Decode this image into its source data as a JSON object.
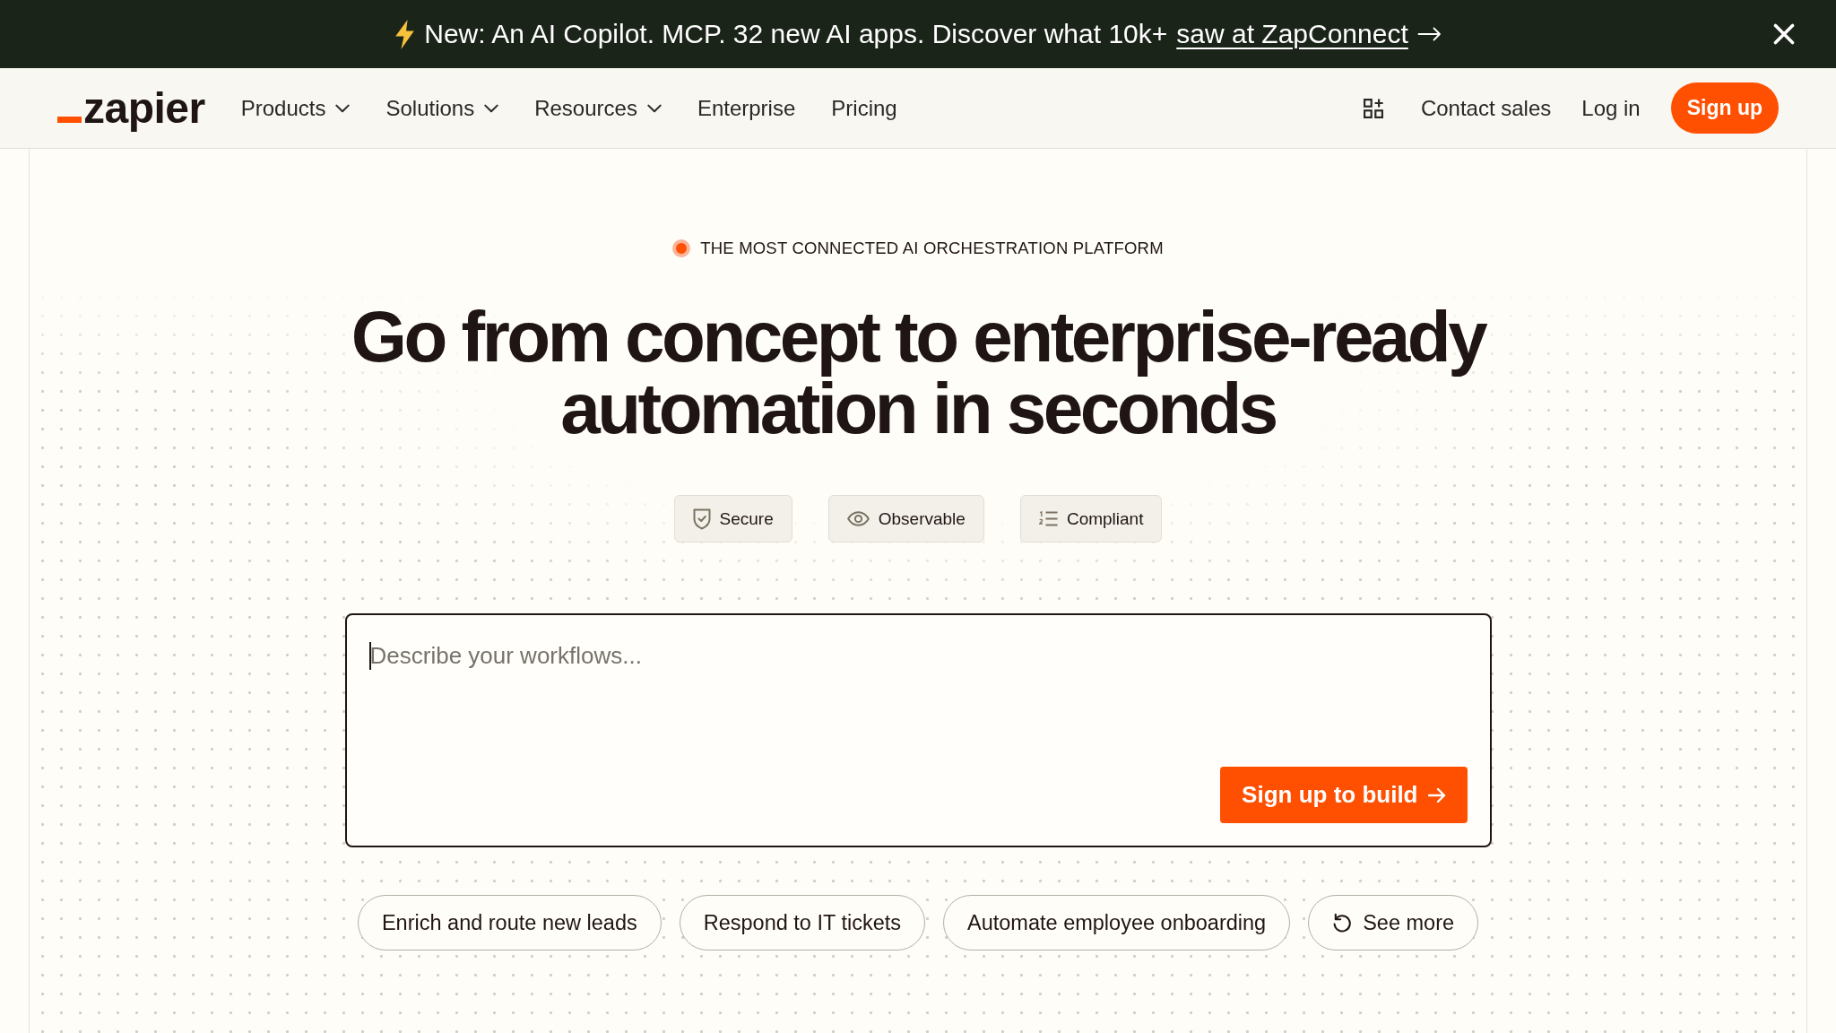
{
  "announcement": {
    "text": "New: An AI Copilot. MCP. 32 new AI apps. Discover what 10k+",
    "link": "saw at ZapConnect"
  },
  "nav": {
    "logo": "zapier",
    "items": [
      {
        "label": "Products",
        "kind": "menu"
      },
      {
        "label": "Solutions",
        "kind": "menu"
      },
      {
        "label": "Resources",
        "kind": "menu"
      },
      {
        "label": "Enterprise",
        "kind": "link"
      },
      {
        "label": "Pricing",
        "kind": "link"
      }
    ],
    "actions": [
      {
        "label": "Contact sales",
        "kind": "link"
      },
      {
        "label": "Log in",
        "kind": "link"
      },
      {
        "label": "Sign up",
        "kind": "primary"
      }
    ]
  },
  "hero": {
    "eyebrow": "THE MOST CONNECTED AI ORCHESTRATION PLATFORM",
    "heading": "Go from concept to enterprise-ready automation in seconds",
    "features": [
      "Secure",
      "Observable",
      "Compliant"
    ]
  },
  "prompt": {
    "placeholder": "Describe your workflows...",
    "focused": true,
    "button": "Sign up to build"
  },
  "suggestions": [
    {
      "label": "Enrich and route new leads",
      "kind": "prompt"
    },
    {
      "label": "Respond to IT tickets",
      "kind": "prompt"
    },
    {
      "label": "Automate employee onboarding",
      "kind": "prompt"
    },
    {
      "label": "See more",
      "kind": "more"
    }
  ]
}
